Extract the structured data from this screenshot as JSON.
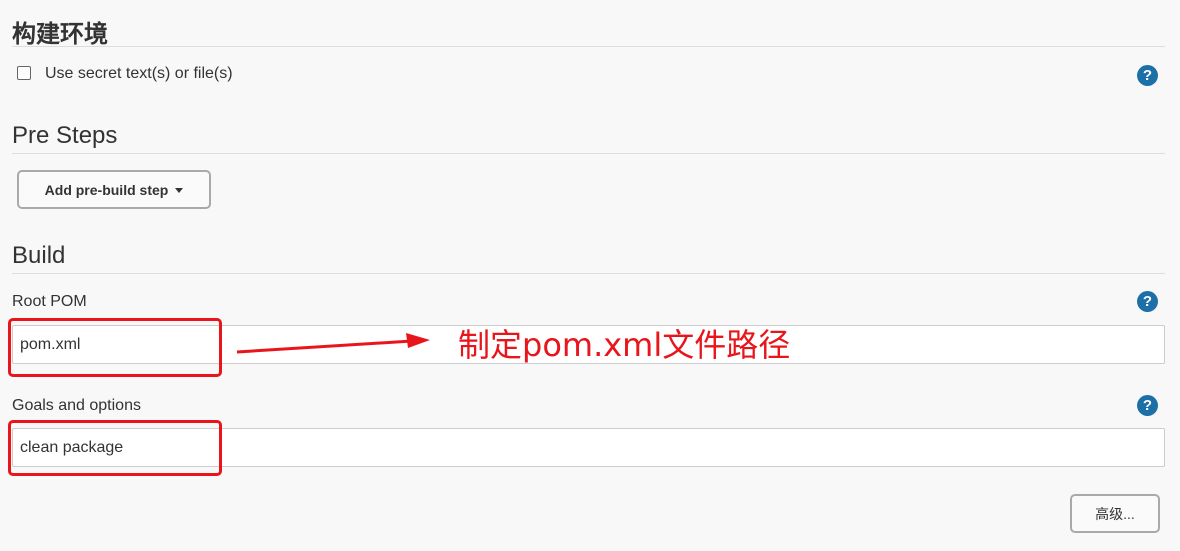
{
  "env_section": {
    "title": "构建环境",
    "secret_checkbox_label": "Use secret text(s) or file(s)",
    "secret_checked": false
  },
  "pre_steps": {
    "title": "Pre Steps",
    "add_button_label": "Add pre-build step"
  },
  "build": {
    "title": "Build",
    "root_pom_label": "Root POM",
    "root_pom_value": "pom.xml",
    "goals_label": "Goals and options",
    "goals_value": "clean package",
    "advanced_button_label": "高级..."
  },
  "help_icon_text": "?",
  "annotation": {
    "text": "制定pom.xml文件路径",
    "color": "#e8151b"
  },
  "colors": {
    "help_icon": "#1d6fa8",
    "highlight": "#e8151b"
  }
}
